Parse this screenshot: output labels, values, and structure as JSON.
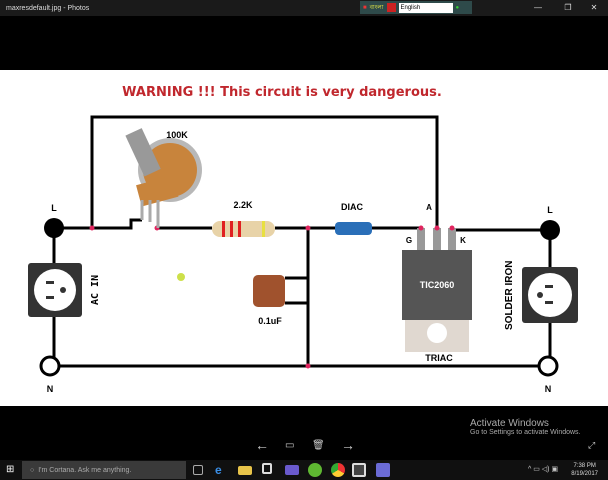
{
  "window": {
    "title": "maxresdefault.jpg - Photos",
    "ime_text": "বাংলা",
    "ime_language": "English",
    "minimize": "—",
    "restore": "❐",
    "close": "✕"
  },
  "circuit": {
    "warning": "WARNING !!! This circuit is very dangerous.",
    "pot_label": "100K",
    "resistor_label": "2.2K",
    "diac_label": "DIAC",
    "cap_label": "0.1uF",
    "triac_part": "TIC2060",
    "triac_label": "TRIAC",
    "pin_a": "A",
    "pin_g": "G",
    "pin_k": "K",
    "left_l": "L",
    "left_n": "N",
    "right_l": "L",
    "right_n": "N",
    "ac_in": "AC IN",
    "solder_iron": "SOLDER IRON",
    "colors": {
      "warning": "#c0272d",
      "wire": "#000000",
      "junction": "#e0245e",
      "outlet": "#333333",
      "capacitor": "#a0522d"
    }
  },
  "viewer": {
    "prev": "←",
    "delete": "🗑",
    "next": "→",
    "watermark_title": "Activate Windows",
    "watermark_sub": "Go to Settings to activate Windows."
  },
  "taskbar": {
    "search_placeholder": "I'm Cortana. Ask me anything.",
    "time": "7:38 PM",
    "date": "8/19/2017"
  }
}
